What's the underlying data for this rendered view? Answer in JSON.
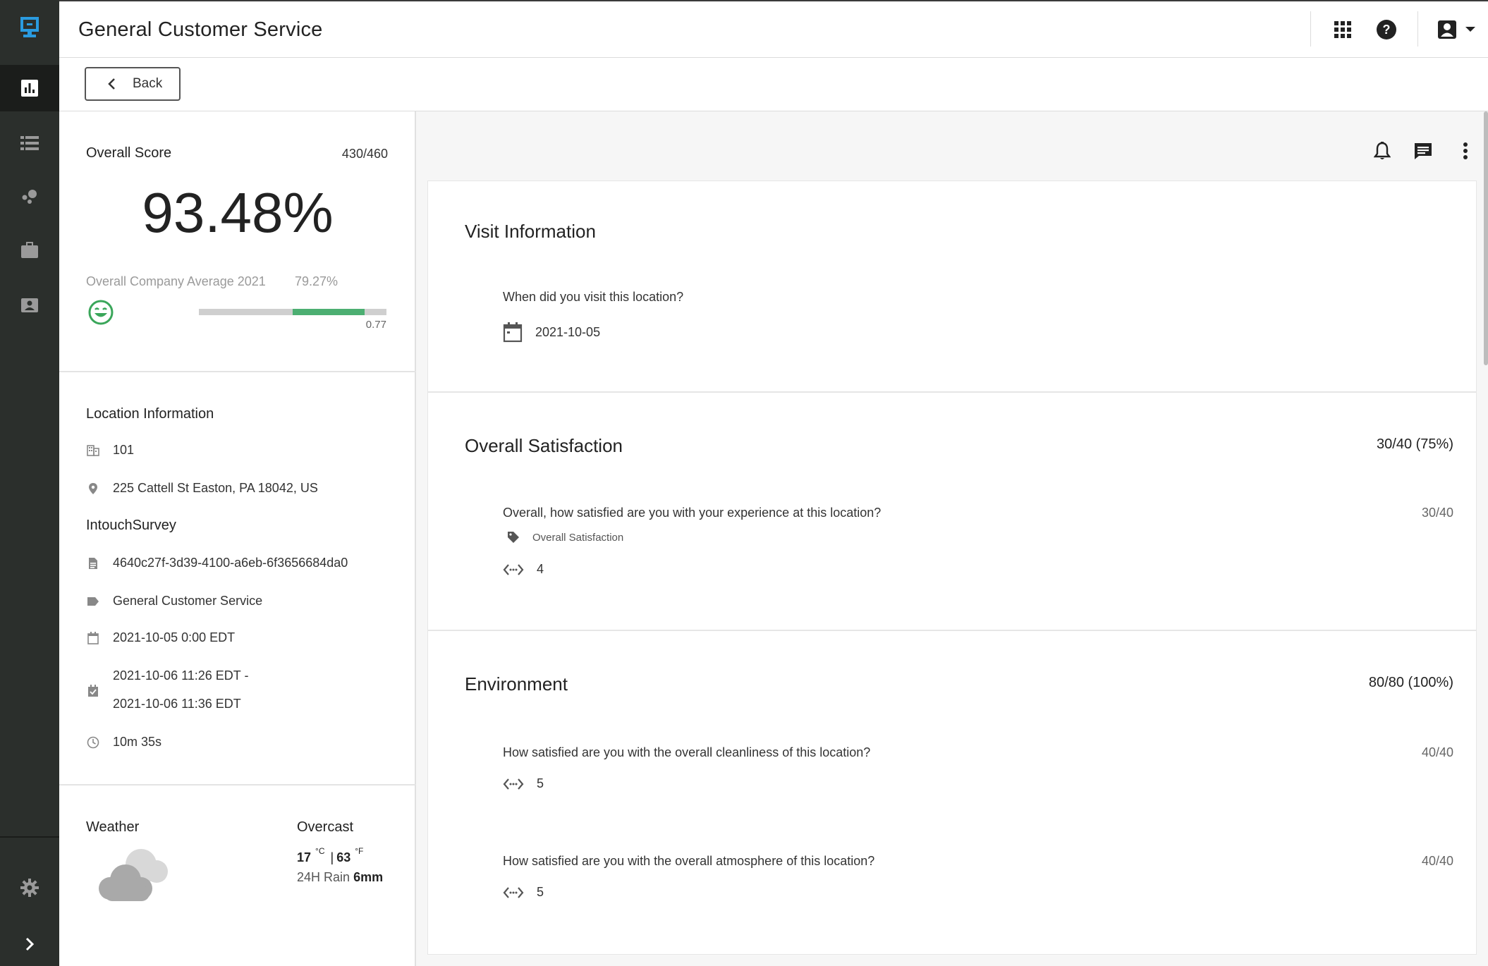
{
  "topbar": {
    "title": "General Customer Service"
  },
  "subbar": {
    "back_label": "Back"
  },
  "overall": {
    "label": "Overall Score",
    "points": "430/460",
    "percent": "93.48%",
    "company_avg_label": "Overall Company Average 2021",
    "company_avg_value": "79.27%",
    "bar_value": "0.77",
    "bar_fill_fraction": 0.77,
    "accent_color": "#4caf72"
  },
  "location": {
    "heading": "Location Information",
    "id": "101",
    "address": "225 Cattell St Easton, PA 18042, US"
  },
  "survey": {
    "heading": "IntouchSurvey",
    "uuid": "4640c27f-3d39-4100-a6eb-6f3656684da0",
    "name": "General Customer Service",
    "date": "2021-10-05 0:00 EDT",
    "range_start": "2021-10-06 11:26 EDT -",
    "range_end": "2021-10-06 11:36 EDT",
    "duration": "10m 35s"
  },
  "weather": {
    "heading": "Weather",
    "condition": "Overcast",
    "temp_c": "17",
    "unit_c": "°C",
    "sep": "|",
    "temp_f": "63",
    "unit_f": "°F",
    "rain_label": "24H Rain",
    "rain_value": "6mm"
  },
  "visit": {
    "title": "Visit Information",
    "question": "When did you visit this location?",
    "answer": "2021-10-05"
  },
  "satisfaction": {
    "title": "Overall Satisfaction",
    "score": "30/40 (75%)",
    "question": "Overall, how satisfied are you with your experience at this location?",
    "q_score": "30/40",
    "tag": "Overall Satisfaction",
    "answer": "4"
  },
  "environment": {
    "title": "Environment",
    "score": "80/80 (100%)",
    "q1": "How satisfied are you with the overall cleanliness of this location?",
    "q1_score": "40/40",
    "q1_answer": "5",
    "q2": "How satisfied are you with the overall atmosphere of this location?",
    "q2_score": "40/40",
    "q2_answer": "5"
  }
}
